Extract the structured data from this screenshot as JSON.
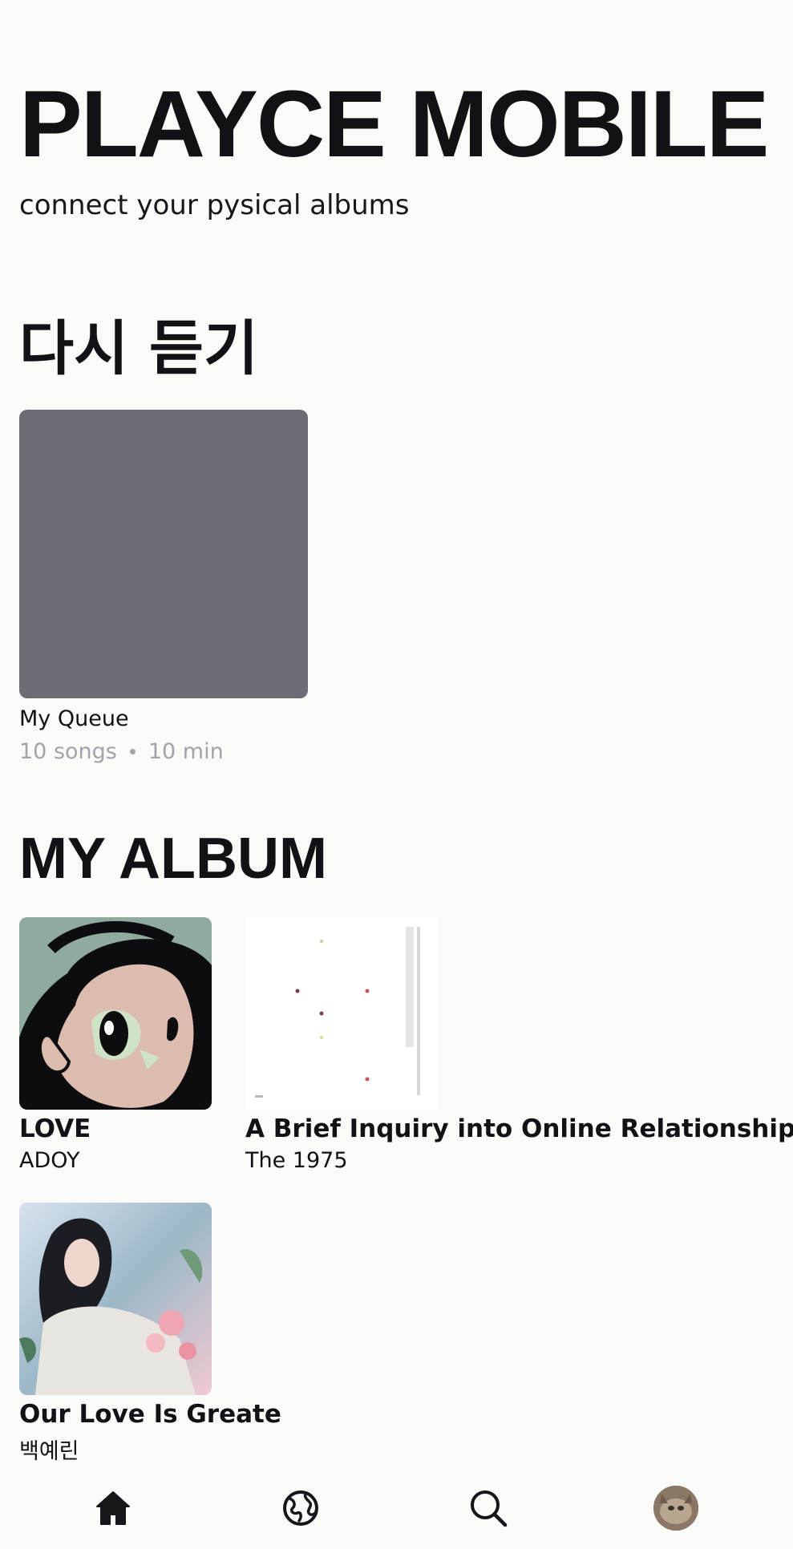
{
  "header": {
    "app_title": "PLAYCE MOBILE",
    "subtitle": "connect your pysical albums"
  },
  "replay": {
    "title": "다시 듣기",
    "queue": {
      "name": "My Queue",
      "songs": "10 songs",
      "duration": "10 min",
      "cover_color": "#6c6d74"
    }
  },
  "my_album": {
    "title": "MY ALBUM",
    "albums": [
      {
        "name": "LOVE",
        "artist": "ADOY"
      },
      {
        "name": "A Brief Inquiry into Online Relationships",
        "artist": "The 1975"
      },
      {
        "name": "Our Love Is Greate",
        "artist": "백예린"
      }
    ]
  },
  "nav": {
    "items": [
      {
        "icon": "home-icon",
        "active": true
      },
      {
        "icon": "globe-icon"
      },
      {
        "icon": "search-icon"
      },
      {
        "icon": "avatar"
      }
    ]
  },
  "colors": {
    "background": "#fafaf8",
    "text": "#111216",
    "muted": "#a2a4ab"
  }
}
